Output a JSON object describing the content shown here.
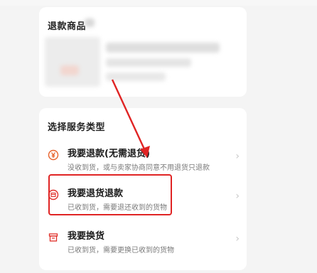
{
  "goods_card": {
    "title": "退款商品"
  },
  "services_card": {
    "title": "选择服务类型",
    "options": [
      {
        "icon": "yen-circle-icon",
        "title": "我要退款(无需退货)",
        "desc": "没收到货，或与卖家协商同意不用退货只退款"
      },
      {
        "icon": "return-goods-icon",
        "title": "我要退货退款",
        "desc": "已收到货，需要退还收到的货物"
      },
      {
        "icon": "exchange-box-icon",
        "title": "我要换货",
        "desc": "已收到货，需要更换已收到的货物"
      }
    ]
  },
  "colors": {
    "annotation_red": "#e02424",
    "icon_orange": "#e8632c",
    "icon_red": "#e0302a"
  }
}
